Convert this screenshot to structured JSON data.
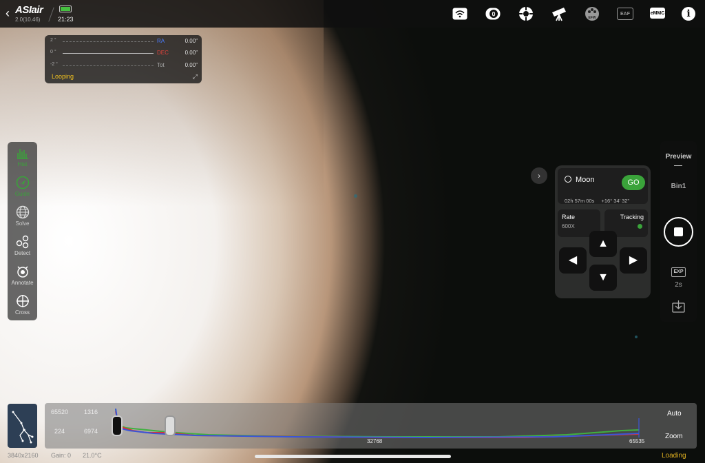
{
  "app": {
    "brand": "ASIair",
    "version": "2.0(10.46)",
    "time": "21:23"
  },
  "topbar_icons": [
    "wifi-icon",
    "camera-icon",
    "guide-scope-icon",
    "telescope-icon",
    "efw-icon",
    "eaf-icon",
    "emmc-icon",
    "info-icon"
  ],
  "topbar_icon_labels": {
    "efw": "EFW",
    "eaf": "EAF",
    "emmc": "eMMC",
    "info": "i"
  },
  "guide_graph": {
    "y_top": "2 °",
    "y_mid": "0 °",
    "y_bot": "-2 °",
    "ra_label": "RA",
    "ra_value": "0.00″",
    "dec_label": "DEC",
    "dec_value": "0.00″",
    "tot_label": "Tot",
    "tot_value": "0.00″",
    "status": "Looping"
  },
  "tools": [
    {
      "label": "Hist"
    },
    {
      "label": "Guide"
    },
    {
      "label": "Solve"
    },
    {
      "label": "Detect"
    },
    {
      "label": "Annotate"
    },
    {
      "label": "Cross"
    }
  ],
  "mount": {
    "target": "Moon",
    "go_label": "GO",
    "ra": "02h 57m 00s",
    "dec": "+16° 34' 32\"",
    "rate_label": "Rate",
    "rate_value": "600X",
    "tracking_label": "Tracking"
  },
  "capture": {
    "mode": "Preview",
    "bin": "Bin1",
    "exp_label": "EXP",
    "exp_value": "2s"
  },
  "histogram": {
    "max_left": "65520",
    "val_right": "1316",
    "min_left": "224",
    "val_right2": "6974",
    "mid_tick": "32768",
    "end_tick": "65535",
    "auto_label": "Auto",
    "zoom_label": "Zoom"
  },
  "footer": {
    "resolution": "3840x2160",
    "gain": "Gain: 0",
    "temp": "21.0°C",
    "loading": "Loading"
  },
  "colors": {
    "accent_green": "#3aa33a",
    "looping_yellow": "#f0c020",
    "ra_blue": "#4a7cff",
    "dec_red": "#e0423a"
  }
}
